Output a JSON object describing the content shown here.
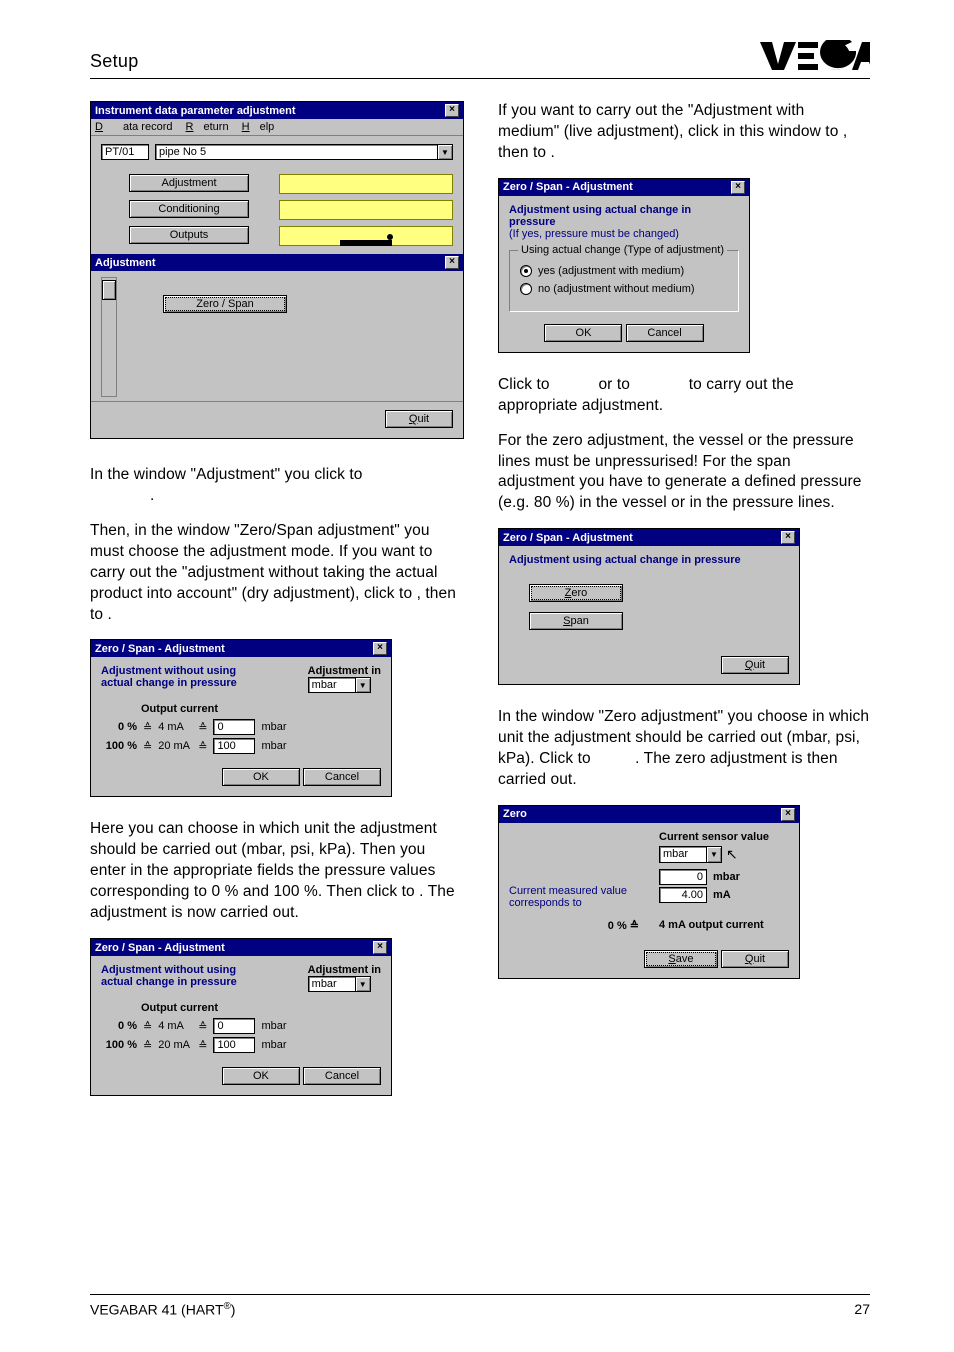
{
  "header": {
    "section": "Setup"
  },
  "footer": {
    "product": "VEGABAR 41 (HART",
    "reg": "®",
    "product_tail": ")",
    "page": "27"
  },
  "win1": {
    "title": "Instrument data parameter adjustment",
    "menu": {
      "data": "Data record",
      "ret": "Return",
      "help": "Help"
    },
    "tag": "PT/01",
    "tag_desc": "pipe No 5",
    "btn_adjust": "Adjustment",
    "btn_cond": "Conditioning",
    "btn_out": "Outputs",
    "sub_title": "Adjustment",
    "btn_zs": "Zero / Span",
    "quit": "Quit"
  },
  "left_p1a": "In the window \"Adjustment\" you click to",
  "left_p1b": ".",
  "left_p2": "Then, in the window \"Zero/Span adjustment\" you must choose the adjustment mode. If you want to carry out the \"adjustment without taking the actual product into account\" (dry adjustment), click to ",
  "left_p2_mid": ", then to ",
  "left_p2_end": ".",
  "zs": {
    "title": "Zero / Span - Adjustment",
    "hdr": "Adjustment without using actual change in pressure",
    "adj_in": "Adjustment in",
    "unit": "mbar",
    "out_cur": "Output current",
    "p0": "0 %",
    "eqA": "≙",
    "ma4": "4 mA",
    "eqB": "≙",
    "v0": "0",
    "u0": "mbar",
    "p100": "100 %",
    "ma20": "20 mA",
    "v100": "100",
    "u100": "mbar",
    "ok": "OK",
    "cancel": "Cancel"
  },
  "left_p3": "Here you can choose in which unit the adjustment should be carried out (mbar, psi, kPa). Then you enter in the appropriate fields the pressure values corresponding to 0 % and 100 %. Then click to ",
  "left_p3_end": ". The adjustment is now carried out.",
  "right_p1": "If you want to carry out the \"Adjustment with medium\" (live adjustment), click in this window to ",
  "right_p1_mid": ", then to ",
  "right_p1_end": ".",
  "yesno": {
    "title": "Zero / Span - Adjustment",
    "line1": "Adjustment using actual change in pressure",
    "line2": "(If yes, pressure must be changed)",
    "grp": "Using actual change  (Type of adjustment)",
    "yes": "yes (adjustment with medium)",
    "no": "no (adjustment without medium)",
    "ok": "OK",
    "cancel": "Cancel"
  },
  "right_p2a": "Click to ",
  "right_p2b": " or to ",
  "right_p2c": " to carry out the appropriate adjustment.",
  "right_p3": "For the zero adjustment, the vessel or the pressure lines must be unpressurised! For the span adjustment you have to generate a defined pressure (e.g. 80 %) in the vessel or in the pressure lines.",
  "zs2": {
    "title": "Zero / Span - Adjustment",
    "hdr": "Adjustment using actual change in pressure",
    "zero": "Zero",
    "span": "Span",
    "quit": "Quit"
  },
  "right_p4a": "In the window \"Zero adjustment\" you choose in which unit the adjustment should be carried out (mbar, psi, kPa). Click to ",
  "right_p4b": ". The zero adjustment is then carried out.",
  "zero": {
    "title": "Zero",
    "csv": "Current sensor value",
    "unit": "mbar",
    "v_mbar": "0",
    "u_mbar": "mbar",
    "v_ma": "4.00",
    "u_ma": "mA",
    "cmv": "Current measured value corresponds to",
    "p0": "0 %  ≙",
    "oc": "4 mA  output current",
    "save": "Save",
    "quit": "Quit"
  }
}
